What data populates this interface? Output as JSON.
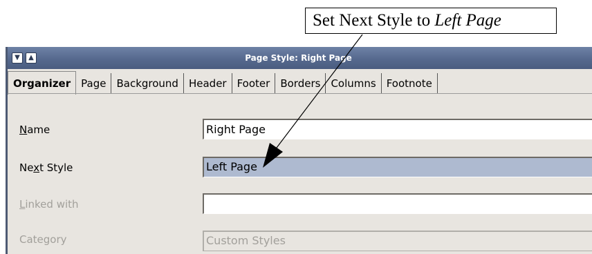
{
  "callout": {
    "text_prefix": "Set Next Style to ",
    "text_italic": "Left Page"
  },
  "window": {
    "title": "Page Style: Right Page",
    "buttons": {
      "menu_icon": "chevron-down-icon",
      "up_icon": "arrow-up-icon"
    }
  },
  "tabs": [
    {
      "label": "Organizer",
      "active": true
    },
    {
      "label": "Page"
    },
    {
      "label": "Background"
    },
    {
      "label": "Header"
    },
    {
      "label": "Footer"
    },
    {
      "label": "Borders"
    },
    {
      "label": "Columns"
    },
    {
      "label": "Footnote"
    }
  ],
  "form": {
    "name": {
      "label_pre": "",
      "label_u": "N",
      "label_post": "ame",
      "value": "Right Page"
    },
    "next": {
      "label_pre": "Ne",
      "label_u": "x",
      "label_post": "t Style",
      "value": "Left Page"
    },
    "linked": {
      "label_pre": "",
      "label_u": "L",
      "label_post": "inked with",
      "value": ""
    },
    "category": {
      "label": "Category",
      "value": "Custom Styles"
    }
  }
}
